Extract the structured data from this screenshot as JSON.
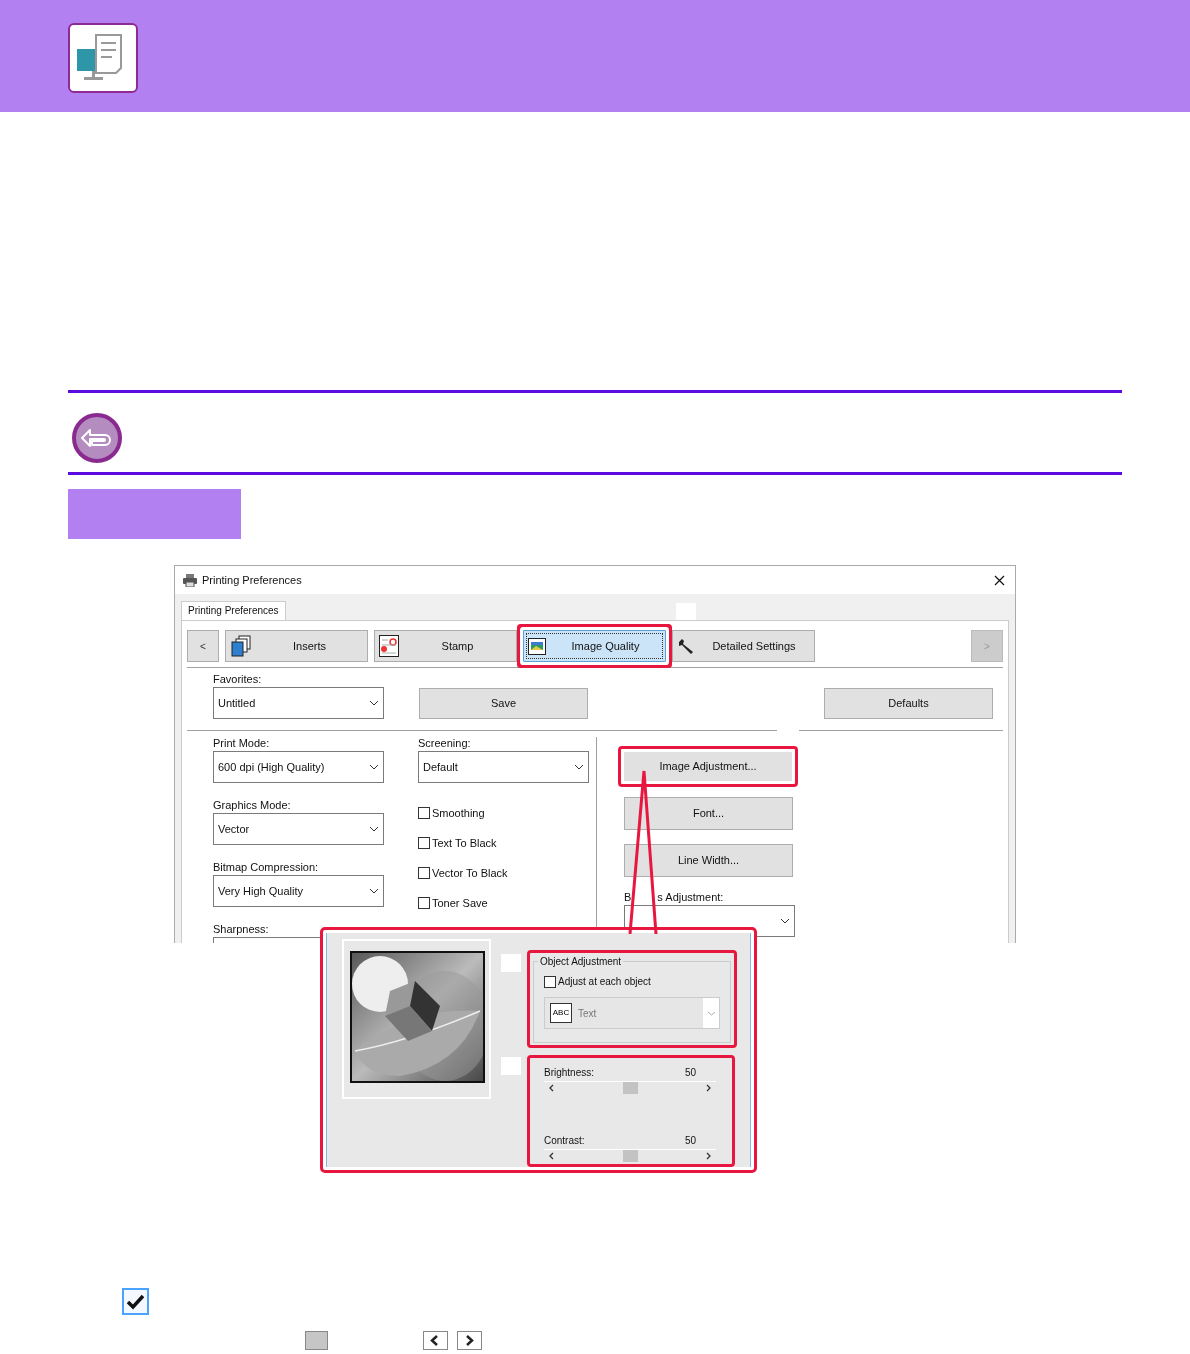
{
  "dialog": {
    "title": "Printing Preferences",
    "sheet_tab": "Printing Preferences",
    "tab_scroll": [
      {
        "label": "<",
        "disabled": false
      },
      {
        "label": ">",
        "disabled": true
      }
    ],
    "tabs": [
      {
        "label": "Inserts",
        "kind": "inserts",
        "selected": false,
        "highlighted": false
      },
      {
        "label": "Stamp",
        "kind": "stamp",
        "selected": false,
        "highlighted": false
      },
      {
        "label": "Image Quality",
        "kind": "image",
        "selected": true,
        "highlighted": true
      },
      {
        "label": "Detailed Settings",
        "kind": "wrench",
        "selected": false,
        "highlighted": false
      }
    ],
    "favorites": {
      "label": "Favorites:",
      "value": "Untitled"
    },
    "save_button": "Save",
    "defaults_button": "Defaults",
    "left_fields": [
      {
        "label": "Print Mode:",
        "value": "600 dpi (High Quality)"
      },
      {
        "label": "Graphics Mode:",
        "value": "Vector"
      },
      {
        "label": "Bitmap Compression:",
        "value": "Very High Quality"
      },
      {
        "label": "Sharpness:"
      }
    ],
    "screening": {
      "label": "Screening:",
      "value": "Default"
    },
    "checkboxes": [
      {
        "label": "Smoothing",
        "checked": false
      },
      {
        "label": "Text To Black",
        "checked": false
      },
      {
        "label": "Vector To Black",
        "checked": false
      },
      {
        "label": "Toner Save",
        "checked": false
      }
    ],
    "buttons": [
      {
        "label": "Image Adjustment...",
        "highlighted": true
      },
      {
        "label": "Font...",
        "highlighted": false
      },
      {
        "label": "Line Width...",
        "highlighted": false
      }
    ],
    "adjustment_field": {
      "label_parts": [
        "B",
        "s Adjustment:"
      ]
    }
  },
  "image_adjustment_panel": {
    "object_adjustment": {
      "title": "Object Adjustment",
      "highlighted": true,
      "checkbox": {
        "label": "Adjust at each object",
        "checked": false
      },
      "dropdown": {
        "icon_text": "ABC",
        "value": "Text",
        "disabled": true
      }
    },
    "sliders_highlighted": true,
    "sliders": [
      {
        "label": "Brightness:",
        "reading": "50",
        "level": 0.5
      },
      {
        "label": "Contrast:",
        "reading": "50",
        "level": 0.5
      }
    ]
  }
}
